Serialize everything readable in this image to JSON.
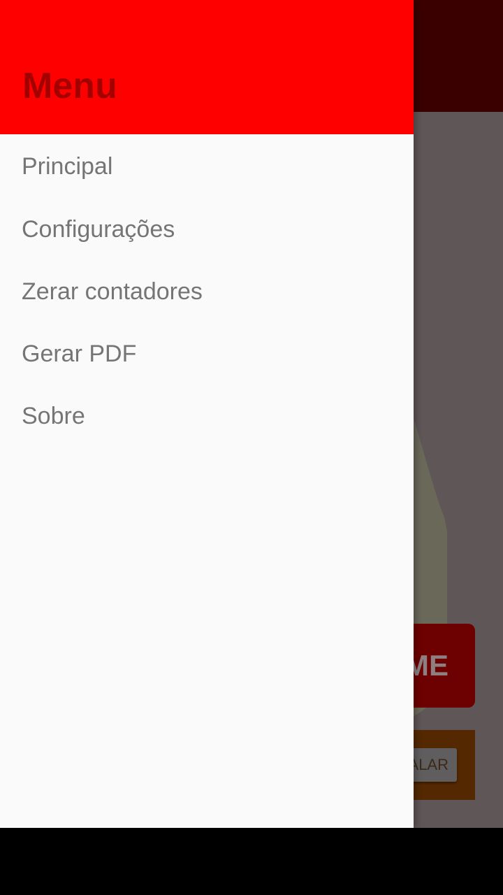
{
  "background_app": {
    "main_button_label": "ME",
    "secondary_button_label": "ALAR"
  },
  "drawer": {
    "title": "Menu",
    "items": [
      {
        "label": "Principal"
      },
      {
        "label": "Configurações"
      },
      {
        "label": "Zerar contadores"
      },
      {
        "label": "Gerar PDF"
      },
      {
        "label": "Sobre"
      }
    ]
  },
  "colors": {
    "header": "#ff0000",
    "header_title": "#a30000",
    "drawer_background": "#fafafa",
    "menu_text": "#757575",
    "scrim": "#5f5657"
  }
}
